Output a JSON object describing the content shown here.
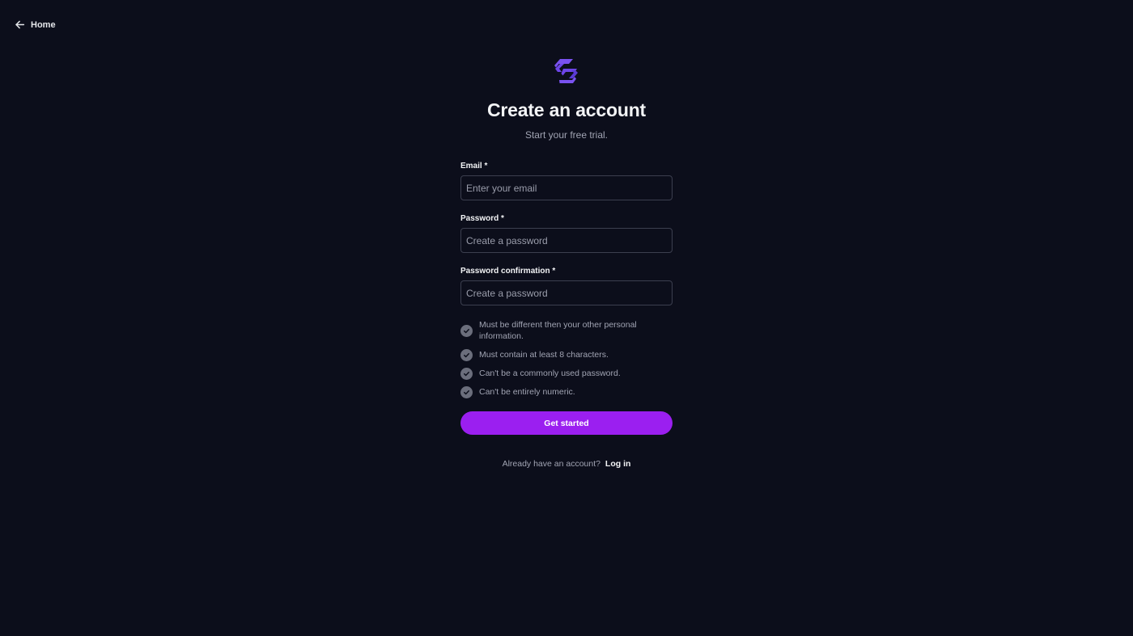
{
  "nav": {
    "home_label": "Home",
    "home_icon": "arrow-left-icon"
  },
  "brand": {
    "logo_icon": "brand-logo-icon",
    "accent_color": "#9b1ff0",
    "logo_color": "#6d45e8"
  },
  "header": {
    "title": "Create an account",
    "subtitle": "Start your free trial."
  },
  "form": {
    "email": {
      "label": "Email *",
      "value": "",
      "placeholder": "Enter your email"
    },
    "password": {
      "label": "Password *",
      "value": "",
      "placeholder": "Create a password"
    },
    "password_confirmation": {
      "label": "Password confirmation *",
      "value": "",
      "placeholder": "Create a password"
    },
    "rules": [
      {
        "text": "Must be different then your other personal information.",
        "icon": "check-icon"
      },
      {
        "text": "Must contain at least 8 characters.",
        "icon": "check-icon"
      },
      {
        "text": "Can't be a commonly used password.",
        "icon": "check-icon"
      },
      {
        "text": "Can't be entirely numeric.",
        "icon": "check-icon"
      }
    ],
    "submit_label": "Get started"
  },
  "footer": {
    "prompt": "Already have an account?",
    "login_label": "Log in"
  },
  "colors": {
    "background": "#0c0e1b",
    "input_border": "#3c3f4f",
    "muted_text": "#a1a4b3",
    "check_badge": "#6b6e7c"
  }
}
